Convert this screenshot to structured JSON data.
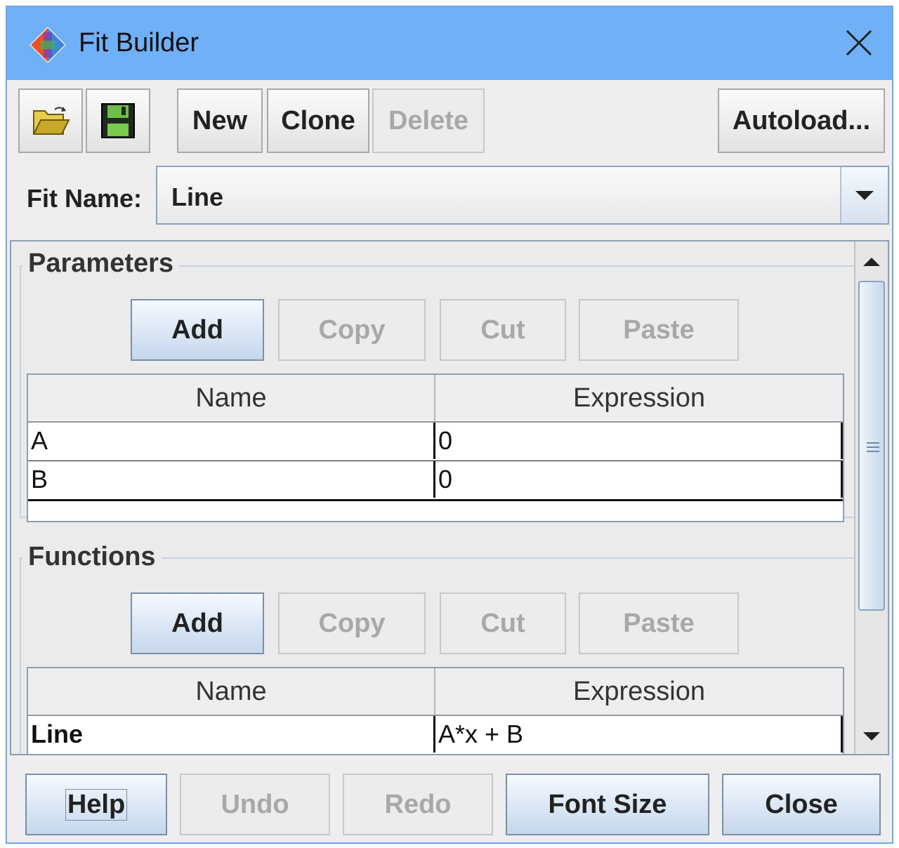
{
  "window": {
    "title": "Fit Builder",
    "colors": {
      "titlebar": "#70b0f6",
      "panel": "#eeeeee"
    }
  },
  "toolbar": {
    "open_icon": "folder-open-icon",
    "save_icon": "floppy-disk-icon",
    "new_label": "New",
    "clone_label": "Clone",
    "delete_label": "Delete",
    "autoload_label": "Autoload..."
  },
  "fit_name": {
    "label": "Fit Name:",
    "value": "Line"
  },
  "parameters": {
    "title": "Parameters",
    "add_label": "Add",
    "copy_label": "Copy",
    "cut_label": "Cut",
    "paste_label": "Paste",
    "columns": [
      "Name",
      "Expression"
    ],
    "rows": [
      {
        "name": "A",
        "expression": "0"
      },
      {
        "name": "B",
        "expression": "0"
      }
    ]
  },
  "functions": {
    "title": "Functions",
    "add_label": "Add",
    "copy_label": "Copy",
    "cut_label": "Cut",
    "paste_label": "Paste",
    "columns": [
      "Name",
      "Expression"
    ],
    "rows": [
      {
        "name": "Line",
        "expression": "A*x + B"
      }
    ]
  },
  "footer": {
    "help_label": "Help",
    "undo_label": "Undo",
    "redo_label": "Redo",
    "font_size_label": "Font Size",
    "close_label": "Close"
  }
}
